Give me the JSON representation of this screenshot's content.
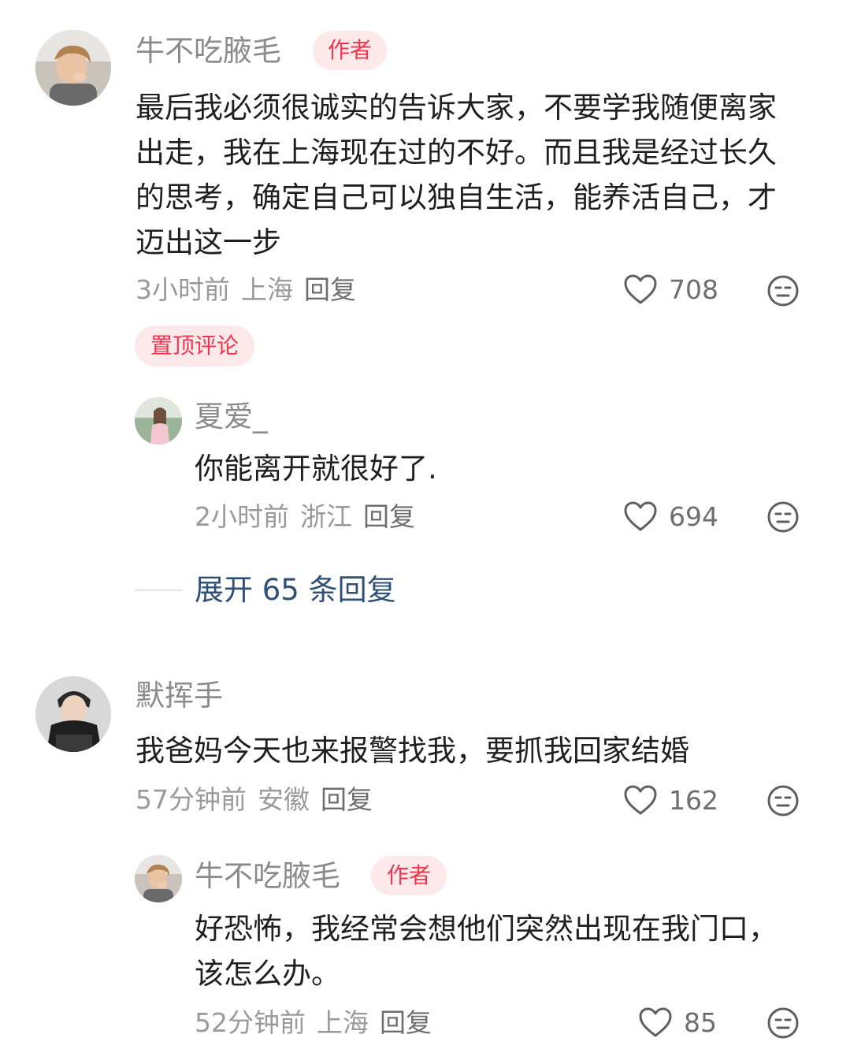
{
  "comments": [
    {
      "username": "牛不吃腋毛",
      "badge": "作者",
      "text": "最后我必须很诚实的告诉大家，不要学我随便离家出走，我在上海现在过的不好。而且我是经过长久的思考，确定自己可以独自生活，能养活自己，才迈出这一步",
      "time": "3小时前",
      "location": "上海",
      "reply_label": "回复",
      "likes": "708",
      "pinned_label": "置顶评论",
      "replies": [
        {
          "username": "夏爱_",
          "text": "你能离开就很好了.",
          "time": "2小时前",
          "location": "浙江",
          "reply_label": "回复",
          "likes": "694"
        }
      ],
      "expand_label": "展开 65 条回复"
    },
    {
      "username": "默挥手",
      "text": "我爸妈今天也来报警找我，要抓我回家结婚",
      "time": "57分钟前",
      "location": "安徽",
      "reply_label": "回复",
      "likes": "162",
      "replies": [
        {
          "username": "牛不吃腋毛",
          "badge": "作者",
          "text": "好恐怖，我经常会想他们突然出现在我门口，该怎么办。",
          "time": "52分钟前",
          "location": "上海",
          "reply_label": "回复",
          "likes": "85"
        }
      ]
    }
  ],
  "icons": {
    "like": "heart-outline-icon",
    "dislike": "neutral-face-icon"
  },
  "colors": {
    "badge_text": "#f0364f",
    "badge_bg": "#fde8ea",
    "expand_link": "#2f4f77",
    "meta": "#9a9a9a"
  }
}
